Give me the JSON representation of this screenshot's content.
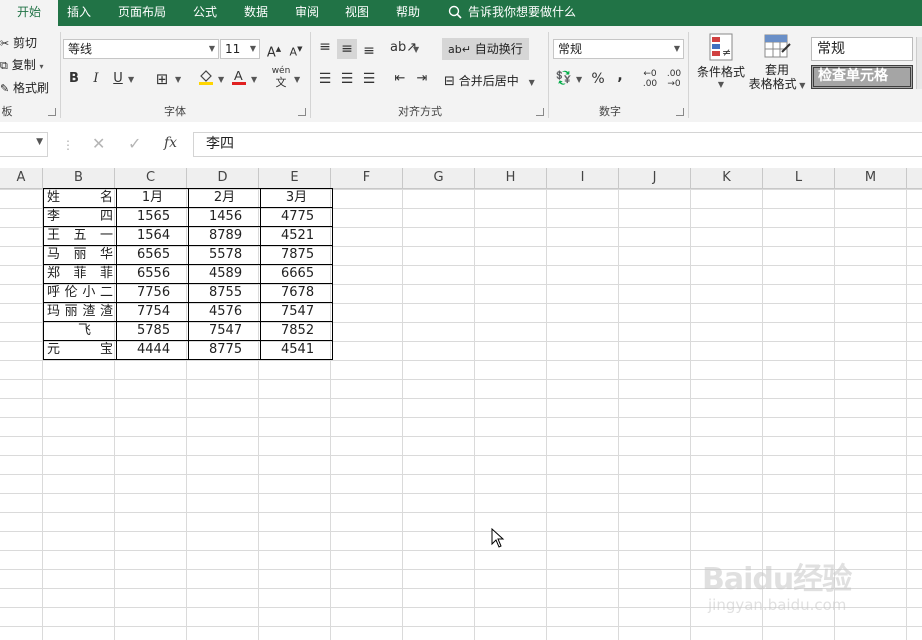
{
  "tabs": [
    {
      "label": "开始",
      "active": true
    },
    {
      "label": "插入"
    },
    {
      "label": "页面布局"
    },
    {
      "label": "公式"
    },
    {
      "label": "数据"
    },
    {
      "label": "审阅"
    },
    {
      "label": "视图"
    },
    {
      "label": "帮助"
    }
  ],
  "tell_me": "告诉我你想要做什么",
  "clipboard": {
    "cut": "剪切",
    "copy": "复制",
    "format_painter": "格式刷",
    "label": "板"
  },
  "font": {
    "name": "等线",
    "size": "11",
    "label": "字体",
    "bold": "B",
    "italic": "I",
    "underline": "U",
    "wen": "wén"
  },
  "alignment": {
    "wrap": "自动换行",
    "merge": "合并后居中",
    "label": "对齐方式"
  },
  "number": {
    "format": "常规",
    "label": "数字",
    "percent": "%",
    "comma": ","
  },
  "styles": {
    "conditional": "条件格式",
    "table_format_line1": "套用",
    "table_format_line2": "表格格式",
    "normal": "常规",
    "check_cell": "检查单元格"
  },
  "formula_bar": {
    "fx": "fx",
    "value": "李四"
  },
  "columns": [
    "A",
    "B",
    "C",
    "D",
    "E",
    "F",
    "G",
    "H",
    "I",
    "J",
    "K",
    "L",
    "M"
  ],
  "table": {
    "header": [
      "姓 名",
      "1月",
      "2月",
      "3月"
    ],
    "rows": [
      {
        "name": "李 四",
        "v": [
          "1565",
          "1456",
          "4775"
        ]
      },
      {
        "name": "王 五 一",
        "v": [
          "1564",
          "8789",
          "4521"
        ]
      },
      {
        "name": "马 丽 华",
        "v": [
          "6565",
          "5578",
          "7875"
        ]
      },
      {
        "name": "郑 菲 菲",
        "v": [
          "6556",
          "4589",
          "6665"
        ]
      },
      {
        "name": "呼伦小二",
        "v": [
          "7756",
          "8755",
          "7678"
        ]
      },
      {
        "name": "玛丽渣渣",
        "v": [
          "7754",
          "4576",
          "7547"
        ]
      },
      {
        "name": "飞",
        "v": [
          "5785",
          "7547",
          "7852"
        ]
      },
      {
        "name": "元 宝",
        "v": [
          "4444",
          "8775",
          "4541"
        ]
      }
    ]
  },
  "watermark": {
    "logo": "Baidu经验",
    "sub": "jingyan.baidu.com"
  },
  "colors": {
    "excel_green": "#217346",
    "font_color": "#e02020",
    "fill_color": "#ffd500"
  }
}
